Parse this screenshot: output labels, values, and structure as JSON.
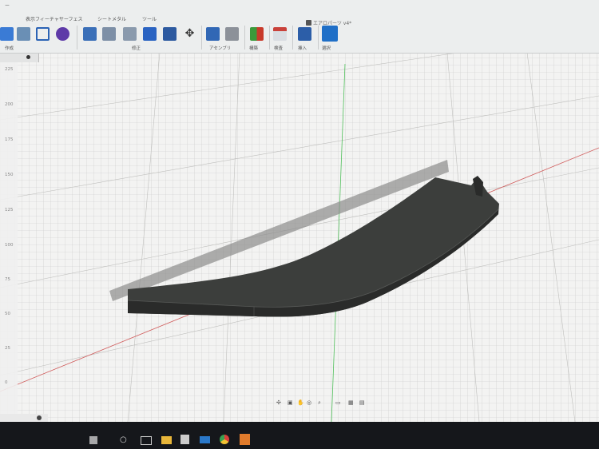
{
  "app": {
    "document_title": "エアロパーツ v4*",
    "tabs": [
      "ー",
      "表示フィーチャサーフェス",
      "シートメタル",
      "ツール"
    ],
    "groups": [
      "作成",
      "修正",
      "アセンブリ",
      "構築",
      "検査",
      "挿入",
      "選択"
    ],
    "colors": {
      "toolbar": "#eceeee",
      "accent": "#1f6fc7",
      "model": "#3f413f"
    }
  },
  "ruler": {
    "labels": [
      "225",
      "200",
      "175",
      "150",
      "125",
      "100",
      "75",
      "50",
      "25",
      "0"
    ]
  },
  "navbar": {
    "icons": [
      "orbit-icon",
      "pan-icon",
      "hand-icon",
      "zoom-fit-icon",
      "zoom-icon",
      "display-icon",
      "grid-icon",
      "viewport-icon"
    ]
  },
  "taskbar": {
    "apps": [
      "windows-icon",
      "search-icon",
      "task-view-icon",
      "file-explorer-icon",
      "store-icon",
      "mail-icon",
      "chrome-icon",
      "fusion-icon"
    ]
  }
}
